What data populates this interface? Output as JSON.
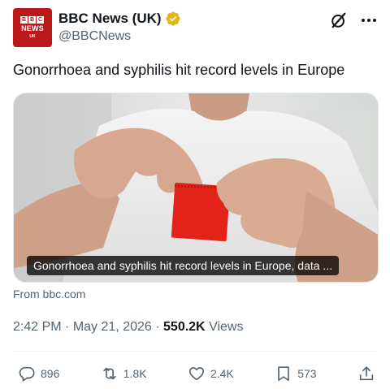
{
  "post": {
    "author": {
      "display_name": "BBC News (UK)",
      "handle": "@BBCNews",
      "verified_icon": "verified-gold-badge",
      "avatar": {
        "logo_letters": [
          "B",
          "B",
          "C"
        ],
        "logo_word": "NEWS",
        "logo_sub": "UK"
      }
    },
    "text": "Gonorrhoea and syphilis hit record levels in Europe",
    "card": {
      "caption": "Gonorrhoea and syphilis hit record levels in Europe, data ...",
      "source": "From bbc.com"
    },
    "meta": {
      "time": "2:42 PM",
      "date": "May 21, 2026",
      "separator": "·",
      "views_count": "550.2K",
      "views_label": "Views"
    },
    "actions": {
      "replies": "896",
      "reposts": "1.8K",
      "likes": "2.4K",
      "bookmarks": "573"
    }
  },
  "colors": {
    "brand_red": "#bb1919",
    "text_primary": "#0f1419",
    "text_secondary": "#536471",
    "verified_gold": "#e2b719",
    "divider": "#eff3f4"
  }
}
